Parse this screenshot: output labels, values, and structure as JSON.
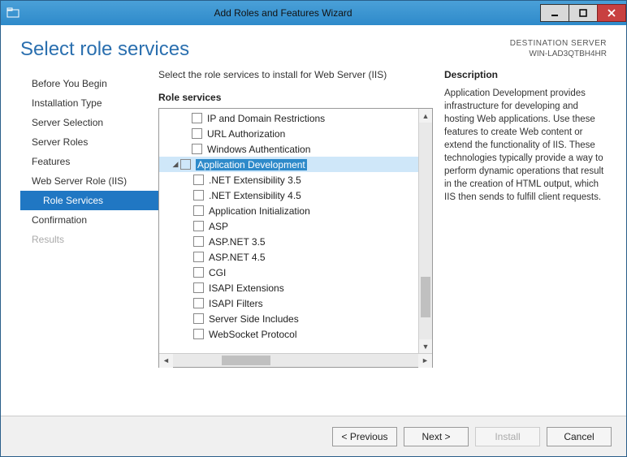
{
  "window": {
    "title": "Add Roles and Features Wizard"
  },
  "header": {
    "page_title": "Select role services",
    "dest_line1": "DESTINATION SERVER",
    "dest_line2": "WIN-LAD3QTBH4HR"
  },
  "sidebar": {
    "items": [
      {
        "label": "Before You Begin"
      },
      {
        "label": "Installation Type"
      },
      {
        "label": "Server Selection"
      },
      {
        "label": "Server Roles"
      },
      {
        "label": "Features"
      },
      {
        "label": "Web Server Role (IIS)"
      },
      {
        "label": "Role Services"
      },
      {
        "label": "Confirmation"
      },
      {
        "label": "Results"
      }
    ]
  },
  "main": {
    "instruction": "Select the role services to install for Web Server (IIS)",
    "section_label": "Role services",
    "tree": [
      {
        "label": "IP and Domain Restrictions",
        "depth": 0
      },
      {
        "label": "URL Authorization",
        "depth": 0
      },
      {
        "label": "Windows Authentication",
        "depth": 0
      },
      {
        "label": "Application Development",
        "depth": 1,
        "selected": true,
        "expandable": true
      },
      {
        "label": ".NET Extensibility 3.5",
        "depth": 2
      },
      {
        "label": ".NET Extensibility 4.5",
        "depth": 2
      },
      {
        "label": "Application Initialization",
        "depth": 2
      },
      {
        "label": "ASP",
        "depth": 2
      },
      {
        "label": "ASP.NET 3.5",
        "depth": 2
      },
      {
        "label": "ASP.NET 4.5",
        "depth": 2
      },
      {
        "label": "CGI",
        "depth": 2
      },
      {
        "label": "ISAPI Extensions",
        "depth": 2
      },
      {
        "label": "ISAPI Filters",
        "depth": 2
      },
      {
        "label": "Server Side Includes",
        "depth": 2
      },
      {
        "label": "WebSocket Protocol",
        "depth": 2
      }
    ]
  },
  "description": {
    "title": "Description",
    "body": "Application Development provides infrastructure for developing and hosting Web applications. Use these features to create Web content or extend the functionality of IIS. These technologies typically provide a way to perform dynamic operations that result in the creation of HTML output, which IIS then sends to fulfill client requests."
  },
  "footer": {
    "previous": "< Previous",
    "next": "Next >",
    "install": "Install",
    "cancel": "Cancel"
  }
}
